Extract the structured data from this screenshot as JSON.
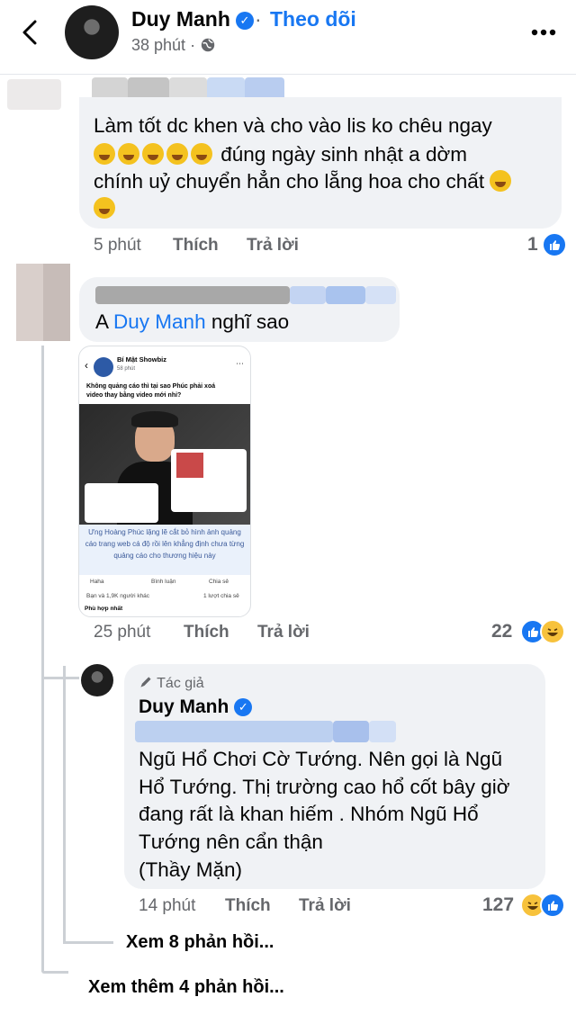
{
  "header": {
    "name": "Duy Manh",
    "separator": "·",
    "follow": "Theo dõi",
    "time": "38 phút",
    "privacy_icon": "globe-icon"
  },
  "comments": [
    {
      "lines": [
        "Làm tốt dc khen và cho vào lis ko chêu ngay",
        "đúng ngày sinh nhật a dờm",
        "chính uỷ chuyển hẳn cho lẵng hoa cho chất",
        ""
      ],
      "time": "5 phút",
      "like": "Thích",
      "reply": "Trả lời",
      "reactions": "1"
    },
    {
      "text_prefix": "A ",
      "mention": "Duy Manh",
      "text_suffix": " nghĩ sao",
      "time": "25 phút",
      "like": "Thích",
      "reply": "Trả lời",
      "reactions": "22",
      "screenshot": {
        "page_name": "Bí Mật Showbiz",
        "page_time": "58 phút",
        "post_text": "Không quảng cáo thì tại sao Phúc phải xoá video thay bằng video mới nhỉ?",
        "caption": "Ưng Hoàng Phúc lặng lẽ cắt bỏ hình ảnh quảng cáo trang web cá độ rồi lên khẳng định chưa từng quảng cáo cho thương hiệu này",
        "haha": "Haha",
        "comment_btn": "Bình luận",
        "share_btn": "Chia sẻ",
        "reactors": "Bạn và 1,9K người khác",
        "shares": "1 lượt chia sẻ",
        "sort": "Phù hợp nhất"
      }
    }
  ],
  "reply": {
    "author_badge": "Tác giả",
    "name": "Duy Manh",
    "lines": [
      "Ngũ Hổ Chơi Cờ Tướng. Nên gọi là Ngũ",
      "Hổ Tướng. Thị trường cao hổ cốt bây giờ",
      "đang rất là khan hiếm . Nhóm Ngũ Hổ",
      "Tướng nên cẩn thận",
      "(Thầy Mặn)"
    ],
    "time": "14 phút",
    "like": "Thích",
    "reply": "Trả lời",
    "reactions": "127"
  },
  "view_replies": "Xem 8 phản hồi...",
  "view_more": "Xem thêm 4 phản hồi..."
}
